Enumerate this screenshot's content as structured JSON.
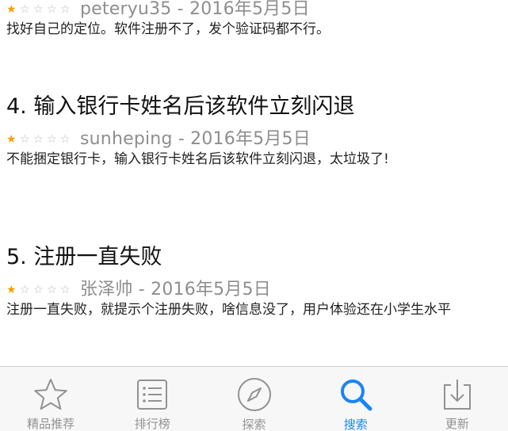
{
  "reviews": [
    {
      "title": "",
      "stars": 1,
      "author": "peteryu35",
      "date": "2016年5月5日",
      "body": "找好自己的定位。软件注册不了，发个验证码都不行。"
    },
    {
      "title": "4. 输入银行卡姓名后该软件立刻闪退",
      "stars": 1,
      "author": "sunheping",
      "date": "2016年5月5日",
      "body": "不能捆定银行卡，输入银行卡姓名后该软件立刻闪退，太垃圾了!"
    },
    {
      "title": "5. 注册一直失败",
      "stars": 1,
      "author": "张泽帅",
      "date": "2016年5月5日",
      "body": "注册一直失败，就提示个注册失败，啥信息没了，用户体验还在小学生水平"
    }
  ],
  "meta_separator": " - ",
  "tab_bar": {
    "tabs": [
      {
        "label": "精品推荐",
        "icon": "star-icon",
        "active": false
      },
      {
        "label": "排行榜",
        "icon": "list-icon",
        "active": false
      },
      {
        "label": "探索",
        "icon": "compass-icon",
        "active": false
      },
      {
        "label": "搜索",
        "icon": "search-icon",
        "active": true
      },
      {
        "label": "更新",
        "icon": "download-icon",
        "active": false
      }
    ]
  },
  "colors": {
    "star_filled": "#f5a000",
    "star_empty": "#b8b8b8",
    "meta_text": "#8e8e8e",
    "tab_inactive": "#929292",
    "tab_active": "#1a84f5"
  }
}
